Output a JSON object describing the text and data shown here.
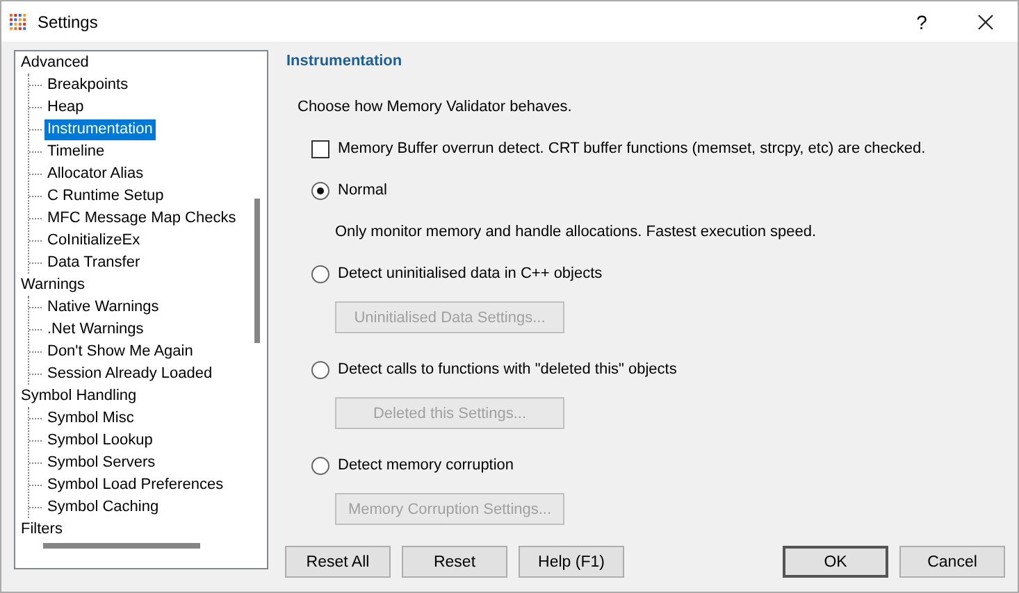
{
  "window": {
    "title": "Settings",
    "help": "?"
  },
  "tree": [
    {
      "label": "Advanced",
      "selected": false,
      "children": [
        {
          "label": "Breakpoints",
          "selected": false
        },
        {
          "label": "Heap",
          "selected": false
        },
        {
          "label": "Instrumentation",
          "selected": true
        },
        {
          "label": "Timeline",
          "selected": false
        },
        {
          "label": "Allocator Alias",
          "selected": false
        },
        {
          "label": "C Runtime Setup",
          "selected": false
        },
        {
          "label": "MFC Message Map Checks",
          "selected": false
        },
        {
          "label": "CoInitializeEx",
          "selected": false
        },
        {
          "label": "Data Transfer",
          "selected": false
        }
      ]
    },
    {
      "label": "Warnings",
      "selected": false,
      "children": [
        {
          "label": "Native Warnings",
          "selected": false
        },
        {
          "label": ".Net Warnings",
          "selected": false
        },
        {
          "label": "Don't Show Me Again",
          "selected": false
        },
        {
          "label": "Session Already Loaded",
          "selected": false
        }
      ]
    },
    {
      "label": "Symbol Handling",
      "selected": false,
      "children": [
        {
          "label": "Symbol Misc",
          "selected": false
        },
        {
          "label": "Symbol Lookup",
          "selected": false
        },
        {
          "label": "Symbol Servers",
          "selected": false
        },
        {
          "label": "Symbol Load Preferences",
          "selected": false
        },
        {
          "label": "Symbol Caching",
          "selected": false
        }
      ]
    },
    {
      "label": "Filters",
      "selected": false
    }
  ],
  "panel": {
    "heading": "Instrumentation",
    "intro": "Choose how Memory Validator behaves.",
    "options": [
      {
        "kind": "checkbox",
        "label": "Memory Buffer overrun detect. CRT buffer functions (memset, strcpy, etc) are checked.",
        "checked": false
      },
      {
        "kind": "radio",
        "label": "Normal",
        "selected": true,
        "description": "Only monitor memory and handle allocations. Fastest execution speed."
      },
      {
        "kind": "radio",
        "label": "Detect uninitialised data in C++ objects",
        "selected": false,
        "settings_button": {
          "label": "Uninitialised Data Settings...",
          "disabled": true
        }
      },
      {
        "kind": "radio",
        "label": "Detect calls to functions with \"deleted this\" objects",
        "selected": false,
        "settings_button": {
          "label": "Deleted this Settings...",
          "disabled": true
        }
      },
      {
        "kind": "radio",
        "label": "Detect memory corruption",
        "selected": false,
        "settings_button": {
          "label": "Memory Corruption Settings...",
          "disabled": true
        }
      }
    ]
  },
  "left_buttons": [
    {
      "label": "Reset All",
      "default": false
    },
    {
      "label": "Reset",
      "default": false
    },
    {
      "label": "Help (F1)",
      "default": false
    }
  ],
  "right_buttons": [
    {
      "label": "OK",
      "default": true
    },
    {
      "label": "Cancel",
      "default": false
    }
  ]
}
